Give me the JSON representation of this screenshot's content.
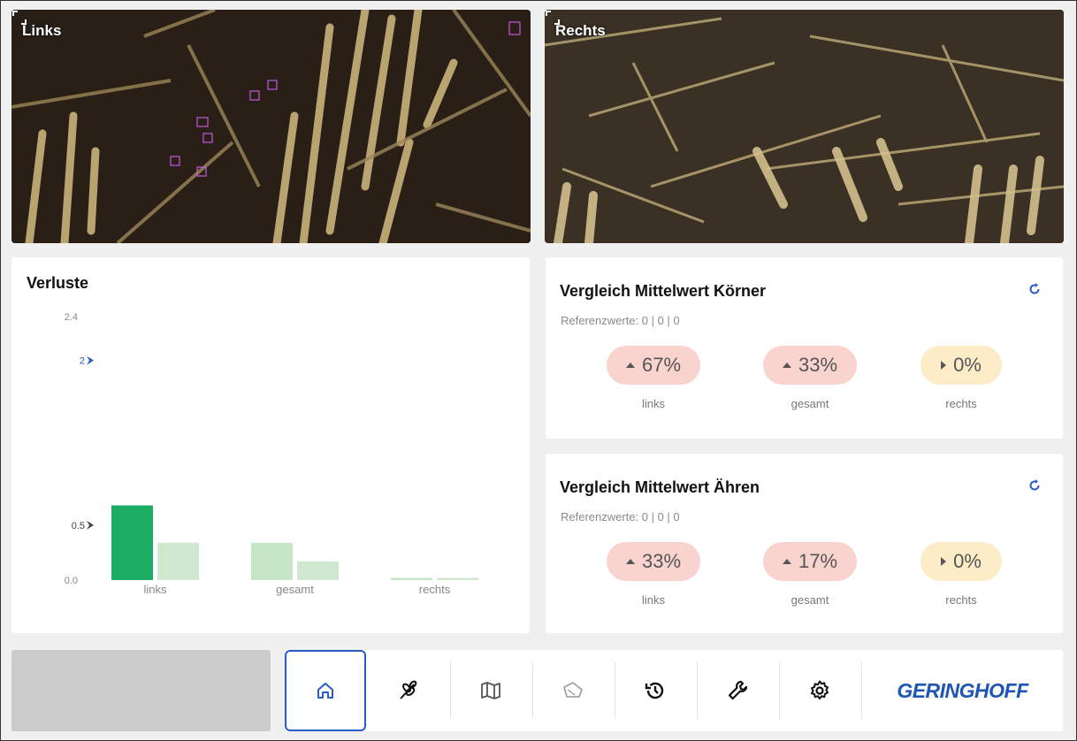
{
  "cameras": {
    "left_title": "Links",
    "right_title": "Rechts",
    "fullscreen_icon": "fullscreen-icon"
  },
  "losses_card": {
    "title": "Verluste"
  },
  "chart_data": {
    "type": "bar",
    "title": "Verluste",
    "categories": [
      "links",
      "gesamt",
      "rechts"
    ],
    "series": [
      {
        "values": [
          0.68,
          0.34,
          0.02
        ]
      },
      {
        "values": [
          0.34,
          0.17,
          0.02
        ]
      }
    ],
    "y_ticks": [
      "2.4",
      "0.0"
    ],
    "markers": [
      "2",
      "0.5"
    ],
    "ylim": [
      0,
      2.4
    ],
    "colors": [
      "#1aad63",
      "#c5e6c7",
      "#cfe8d0"
    ],
    "marker_colors": [
      "#2a5bc7",
      "#444444"
    ]
  },
  "kornel_card": {
    "title": "Vergleich Mittelwert Körner",
    "reference": "Referenzwerte: 0 | 0 | 0",
    "items": [
      {
        "value": "67%",
        "label": "links",
        "trend": "up"
      },
      {
        "value": "33%",
        "label": "gesamt",
        "trend": "up"
      },
      {
        "value": "0%",
        "label": "rechts",
        "trend": "neutral"
      }
    ]
  },
  "ahren_card": {
    "title": "Vergleich Mittelwert Ähren",
    "reference": "Referenzwerte: 0 | 0 | 0",
    "items": [
      {
        "value": "33%",
        "label": "links",
        "trend": "up"
      },
      {
        "value": "17%",
        "label": "gesamt",
        "trend": "up"
      },
      {
        "value": "0%",
        "label": "rechts",
        "trend": "neutral"
      }
    ]
  },
  "colors": {
    "pill_red": "#f9d3ce",
    "pill_yellow": "#fcedc8",
    "accent": "#2a5bc7",
    "brand": "#1f56b5"
  },
  "navigation": {
    "items": [
      "home-icon",
      "grain-icon",
      "map-icon",
      "field-icon",
      "history-icon",
      "wrench-icon",
      "gear-icon"
    ],
    "active": "home-icon",
    "brand": "GERINGHOFF"
  }
}
